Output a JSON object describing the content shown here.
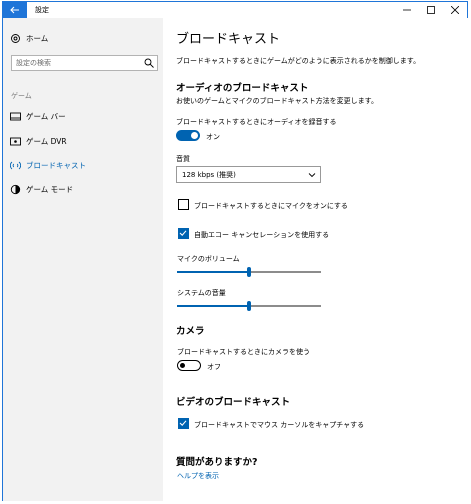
{
  "window": {
    "title": "設定"
  },
  "sidebar": {
    "home": "ホーム",
    "search_placeholder": "設定の検索",
    "section": "ゲーム",
    "items": [
      {
        "label": "ゲーム バー",
        "icon": "game-bar-icon"
      },
      {
        "label": "ゲーム DVR",
        "icon": "game-dvr-icon"
      },
      {
        "label": "ブロードキャスト",
        "icon": "broadcast-icon",
        "active": true
      },
      {
        "label": "ゲーム モード",
        "icon": "game-mode-icon"
      }
    ]
  },
  "main": {
    "title": "ブロードキャスト",
    "description": "ブロードキャストするときにゲームがどのように表示されるかを制御します。",
    "audio": {
      "heading": "オーディオのブロードキャスト",
      "description": "お使いのゲームとマイクのブロードキャスト方法を変更します。",
      "record_audio_label": "ブロードキャストするときにオーディオを録音する",
      "record_audio_state": "オン",
      "record_audio_on": true,
      "quality_label": "音質",
      "quality_value": "128 kbps (推奨)",
      "mic_on_label": "ブロードキャストするときにマイクをオンにする",
      "mic_on_checked": false,
      "echo_cancel_label": "自動エコー キャンセレーションを使用する",
      "echo_cancel_checked": true,
      "mic_volume_label": "マイクのボリューム",
      "mic_volume": 0.5,
      "system_volume_label": "システムの音量",
      "system_volume": 0.5
    },
    "camera": {
      "heading": "カメラ",
      "use_camera_label": "ブロードキャストするときにカメラを使う",
      "use_camera_state": "オフ",
      "use_camera_on": false
    },
    "video": {
      "heading": "ビデオのブロードキャスト",
      "capture_cursor_label": "ブロードキャストでマウス カーソルをキャプチャする",
      "capture_cursor_checked": true
    },
    "help": {
      "heading": "質問がありますか?",
      "link": "ヘルプを表示"
    }
  },
  "colors": {
    "accent": "#0063b1",
    "titlebar_accent": "#1f75d8",
    "sidebar_bg": "#f2f2f2"
  }
}
